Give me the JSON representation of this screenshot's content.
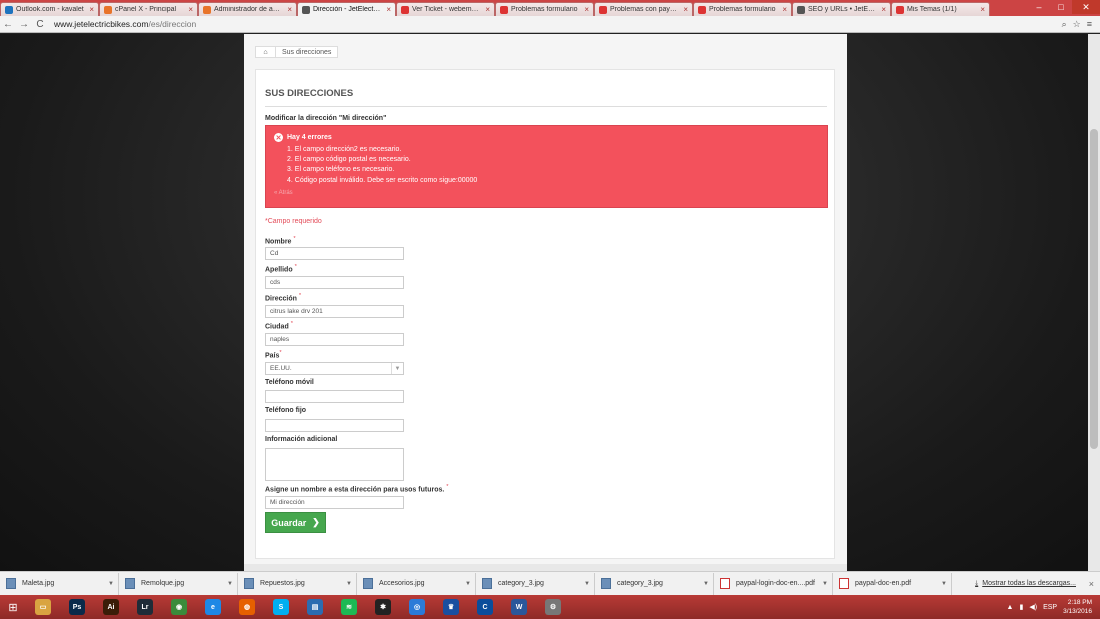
{
  "browser": {
    "tabs": [
      {
        "label": "Outlook.com - kavalet",
        "color": "#1e73be"
      },
      {
        "label": "cPanel X - Principal",
        "color": "#e8742a"
      },
      {
        "label": "Administrador de arch",
        "color": "#e8742a"
      },
      {
        "label": "Dirección - JetElectricB",
        "color": "#555555",
        "active": true
      },
      {
        "label": "Ver Ticket - webempre",
        "color": "#d33"
      },
      {
        "label": "Problemas formulario",
        "color": "#d33"
      },
      {
        "label": "Problemas con paypal",
        "color": "#d33"
      },
      {
        "label": "Problemas formulario",
        "color": "#d33"
      },
      {
        "label": "SEO y URLs • JetElect",
        "color": "#555555"
      },
      {
        "label": "Mis Temas (1/1)",
        "color": "#d33"
      }
    ],
    "url_host": "www.jetelectricbikes.com",
    "url_path": "/es/direccion",
    "back": "←",
    "forward": "→",
    "reload": "C",
    "zoom": "⌕",
    "star": "☆",
    "menu": "≡"
  },
  "breadcrumb": {
    "home_icon": "⌂",
    "current": "Sus direcciones"
  },
  "page": {
    "title": "SUS DIRECCIONES",
    "subtitle": "Modificar la dirección \"Mi dirección\"",
    "error_title": "Hay 4 errores",
    "errors": [
      "1. El campo dirección2 es necesario.",
      "2. El campo código postal es necesario.",
      "3. El campo teléfono es necesario.",
      "4. Código postal inválido. Debe ser escrito como sigue:00000"
    ],
    "error_back": "« Atrás",
    "required_note": "*Campo requerido",
    "fields": {
      "nombre_label": "Nombre",
      "nombre_value": "Cd",
      "apellido_label": "Apellido",
      "apellido_value": "cds",
      "direccion_label": "Dirección",
      "direccion_value": "citrus lake drv 201",
      "ciudad_label": "Ciudad",
      "ciudad_value": "naples",
      "pais_label": "País",
      "pais_value": "EE.UU.",
      "movil_label": "Teléfono móvil",
      "movil_value": "",
      "fijo_label": "Teléfono fijo",
      "fijo_value": "",
      "info_label": "Información adicional",
      "alias_label": "Asigne un nombre a esta dirección para usos futuros.",
      "alias_value": "Mi dirección"
    },
    "star": "*",
    "save_button": "Guardar",
    "save_chevron": "❯"
  },
  "downloads": {
    "items": [
      {
        "name": "Maleta.jpg",
        "type": "img"
      },
      {
        "name": "Remolque.jpg",
        "type": "img"
      },
      {
        "name": "Repuestos.jpg",
        "type": "img"
      },
      {
        "name": "Accesorios.jpg",
        "type": "img"
      },
      {
        "name": "category_3.jpg",
        "type": "img"
      },
      {
        "name": "category_3.jpg",
        "type": "img"
      },
      {
        "name": "paypal-login-doc-en....pdf",
        "type": "pdf"
      },
      {
        "name": "paypal-doc-en.pdf",
        "type": "pdf"
      }
    ],
    "show_all": "Mostrar todas las descargas...",
    "close": "×"
  },
  "taskbar": {
    "apps": [
      {
        "name": "file-explorer",
        "glyph": "▭",
        "color": "#d9a441"
      },
      {
        "name": "photoshop",
        "glyph": "Ps",
        "color": "#0b2a4a"
      },
      {
        "name": "illustrator",
        "glyph": "Ai",
        "color": "#3b1d08"
      },
      {
        "name": "lightroom",
        "glyph": "Lr",
        "color": "#1f2c38"
      },
      {
        "name": "chrome",
        "glyph": "◉",
        "color": "#3b8b3b"
      },
      {
        "name": "internet-explorer",
        "glyph": "e",
        "color": "#1e88e5"
      },
      {
        "name": "firefox",
        "glyph": "◍",
        "color": "#e66000"
      },
      {
        "name": "skype",
        "glyph": "S",
        "color": "#00aff0"
      },
      {
        "name": "notes",
        "glyph": "▤",
        "color": "#2b6cb0"
      },
      {
        "name": "spotify",
        "glyph": "≋",
        "color": "#1db954"
      },
      {
        "name": "app-star",
        "glyph": "✱",
        "color": "#222"
      },
      {
        "name": "app-target",
        "glyph": "◎",
        "color": "#2b7bd8"
      },
      {
        "name": "app-crown",
        "glyph": "♛",
        "color": "#1a4fa0"
      },
      {
        "name": "app-c",
        "glyph": "C",
        "color": "#0a4d9b"
      },
      {
        "name": "word",
        "glyph": "W",
        "color": "#2b579a"
      },
      {
        "name": "app-gear",
        "glyph": "⚙",
        "color": "#777"
      }
    ],
    "language": "ESP",
    "time": "2:18 PM",
    "date": "3/13/2016"
  }
}
